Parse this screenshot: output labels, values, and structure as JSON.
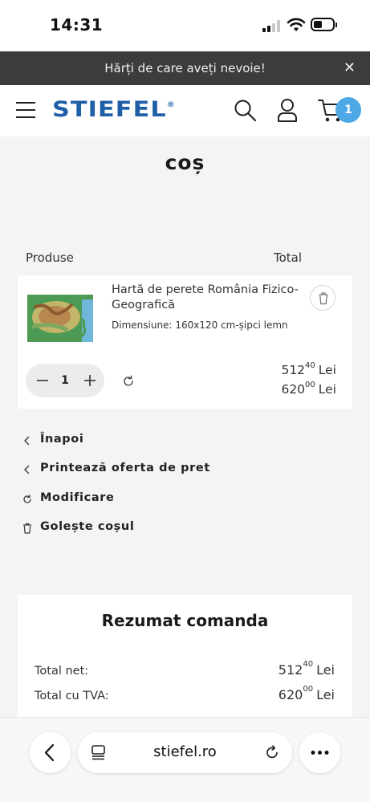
{
  "status_bar": {
    "time": "14:31"
  },
  "promo_banner": {
    "text": "Hărți de care aveți nevoie!",
    "close_icon": "close-icon"
  },
  "header": {
    "logo_text": "STIEFEL",
    "logo_mark": "®",
    "cart_count": "1",
    "icons": [
      "menu-icon",
      "search-icon",
      "user-icon",
      "cart-icon"
    ]
  },
  "page": {
    "title": "coș"
  },
  "table": {
    "col_product": "Produse",
    "col_total": "Total"
  },
  "cart_item": {
    "name": "Hartă de perete România Fizico-Geografică",
    "dimension_label": "Dimensiune:",
    "dimension_value": "160x120 cm-șipci lemn",
    "quantity": "1",
    "price_net_int": "512",
    "price_net_dec": "40",
    "price_gross_int": "620",
    "price_gross_dec": "00",
    "currency": "Lei"
  },
  "actions": [
    {
      "label": "Înapoi",
      "icon": "chevron-left-icon"
    },
    {
      "label": "Printează oferta de pret",
      "icon": "chevron-left-icon"
    },
    {
      "label": "Modificare",
      "icon": "refresh-icon"
    },
    {
      "label": "Golește coșul",
      "icon": "trash-icon"
    }
  ],
  "summary": {
    "title": "Rezumat comanda",
    "net_label": "Total net:",
    "net_int": "512",
    "net_dec": "40",
    "gross_label": "Total cu TVA:",
    "gross_int": "620",
    "gross_dec": "00",
    "currency": "Lei"
  },
  "browser": {
    "url": "stiefel.ro"
  },
  "colors": {
    "brand": "#1f5fa8",
    "badge": "#4ea8e6",
    "banner": "#3c3c3c",
    "background": "#f4f4f4"
  }
}
